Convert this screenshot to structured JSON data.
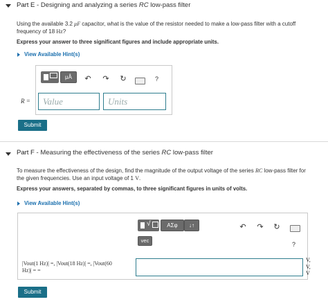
{
  "partE": {
    "title_prefix": "Part E",
    "title_rest": " - Designing and analyzing a series ",
    "title_rc": "RC",
    "title_end": " low-pass filter",
    "question_line1_a": "Using the available 3.2 ",
    "question_unit": "μF",
    "question_line1_b": " capacitor, what is the value of the resistor needed to make a low-pass filter with a cutoff",
    "question_line2_a": "frequency of 18 ",
    "question_line2_unit": "Hz",
    "question_line2_b": "?",
    "instruction": "Express your answer to three significant figures and include appropriate units.",
    "hint_link": "View Available Hint(s)",
    "toolbar": {
      "mu_a": "μÅ",
      "help": "?"
    },
    "answer_label": "R =",
    "value_placeholder": "Value",
    "units_placeholder": "Units",
    "submit_label": "Submit"
  },
  "partF": {
    "title_prefix": "Part F",
    "title_rest": " - Measuring the effectiveness of the series ",
    "title_rc": "RC",
    "title_end": " low-pass filter",
    "question_line1_a": "To measure the effectiveness of the design, find the magnitude of the output voltage of the series ",
    "question_rc": "RC",
    "question_line1_b": " low-pass filter for",
    "question_line2_a": "the given frequencies. Use an input voltage of 1 ",
    "question_line2_unit": "V",
    "question_line2_b": ".",
    "instruction": "Express your answers, separated by commas, to three significant figures in units of volts.",
    "hint_link": "View Available Hint(s)",
    "toolbar": {
      "greek": "ΑΣφ",
      "arrows": "↓↑",
      "vec": "vec",
      "help": "?"
    },
    "answer_label_line1": "|Vout(1 Hz)| =, |Vout(18 Hz)| =, |Vout(60",
    "answer_label_line2": "Hz)| = =",
    "unit_v1": "V,",
    "unit_v2": "V,",
    "unit_v3": "V",
    "submit_label": "Submit"
  }
}
